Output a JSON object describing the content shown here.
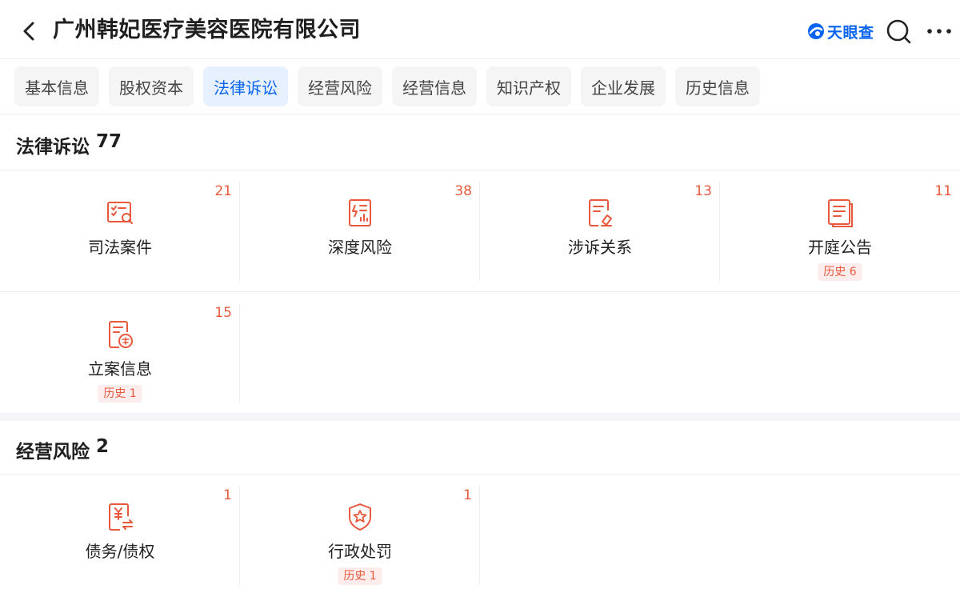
{
  "header": {
    "title": "广州韩妃医疗美容医院有限公司",
    "brand": "天眼查",
    "brand_color": "#0a64f0",
    "back_icon": "chevron-left-icon",
    "search_icon": "search-icon",
    "more_icon": "more-icon"
  },
  "tabs": [
    {
      "label": "基本信息",
      "active": false
    },
    {
      "label": "股权资本",
      "active": false
    },
    {
      "label": "法律诉讼",
      "active": true
    },
    {
      "label": "经营风险",
      "active": false
    },
    {
      "label": "经营信息",
      "active": false
    },
    {
      "label": "知识产权",
      "active": false
    },
    {
      "label": "企业发展",
      "active": false
    },
    {
      "label": "历史信息",
      "active": false
    }
  ],
  "sections": {
    "legal": {
      "title": "法律诉讼",
      "count": "77",
      "items": [
        {
          "label": "司法案件",
          "count": "21",
          "icon": "judicial-case-icon"
        },
        {
          "label": "深度风险",
          "count": "38",
          "icon": "deep-risk-icon"
        },
        {
          "label": "涉诉关系",
          "count": "13",
          "icon": "litigation-relation-icon"
        },
        {
          "label": "开庭公告",
          "count": "11",
          "icon": "court-notice-icon",
          "history": "历史 6"
        },
        {
          "label": "立案信息",
          "count": "15",
          "icon": "case-filing-icon",
          "history": "历史 1"
        }
      ]
    },
    "risk": {
      "title": "经营风险",
      "count": "2",
      "items": [
        {
          "label": "债务/债权",
          "count": "1",
          "icon": "debt-icon"
        },
        {
          "label": "行政处罚",
          "count": "1",
          "icon": "penalty-shield-icon",
          "history": "历史 1"
        }
      ]
    }
  },
  "accent_color": "#e7583d",
  "active_tab_color": "#0a64f0"
}
